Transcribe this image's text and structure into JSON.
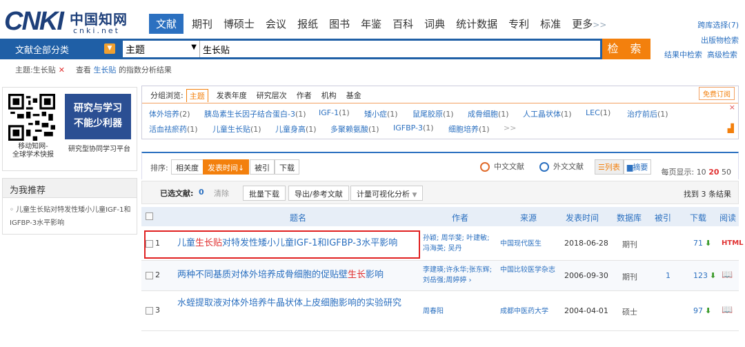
{
  "logo": {
    "brand": "CNKI",
    "chinese": "中国知网",
    "domain": "cnki.net"
  },
  "topnav": {
    "active": "文献",
    "items": [
      "期刊",
      "博硕士",
      "会议",
      "报纸",
      "图书",
      "年鉴",
      "百科",
      "词典",
      "统计数据",
      "专利",
      "标准"
    ],
    "more": "更多",
    "more_arrow": ">>"
  },
  "rightlinks": {
    "cross_db": "跨库选择(7)",
    "publisher": "出版物检索"
  },
  "search": {
    "category": "文献全部分类",
    "field": "主题",
    "query": "生长贴",
    "button": "检 索",
    "in_results": "结果中检索",
    "advanced": "高级检索"
  },
  "crumbs": {
    "term": "主题:生长贴",
    "close": "✕",
    "analyze_prefix": "查看",
    "analyze_kw": "生长贴",
    "analyze_suffix": "的指数分析结果"
  },
  "promo": {
    "qr_caption": "移动知网-\n全球学术快报",
    "banner_text": "研究与学习\n不能少利器",
    "banner_caption": "研究型协同学习平台"
  },
  "recommend": {
    "heading": "为我推荐",
    "item": "儿童生长贴对特发性矮小儿童IGF-1和IGFBP-3水平影响"
  },
  "group": {
    "label": "分组浏览:",
    "tabs": [
      "主题",
      "发表年度",
      "研究层次",
      "作者",
      "机构",
      "基金"
    ],
    "subscribe": "免费订阅",
    "close": "×",
    "chart_icon": "▟",
    "row1": [
      {
        "t": "体外培养",
        "c": "(2)"
      },
      {
        "t": "胰岛素生长因子结合蛋白-3",
        "c": "(1)"
      },
      {
        "t": "IGF-1",
        "c": "(1)"
      },
      {
        "t": "矮小症",
        "c": "(1)"
      },
      {
        "t": "鼠尾胶原",
        "c": "(1)"
      },
      {
        "t": "成骨细胞",
        "c": "(1)"
      },
      {
        "t": "人工晶状体",
        "c": "(1)"
      },
      {
        "t": "LEC",
        "c": "(1)"
      },
      {
        "t": "治疗前后",
        "c": "(1)"
      }
    ],
    "row2": [
      {
        "t": "活血祛瘀药",
        "c": "(1)"
      },
      {
        "t": "儿童生长贴",
        "c": "(1)"
      },
      {
        "t": "儿童身高",
        "c": "(1)"
      },
      {
        "t": "多聚赖氨酸",
        "c": "(1)"
      },
      {
        "t": "IGFBP-3",
        "c": "(1)"
      },
      {
        "t": "细胞培养",
        "c": "(1)"
      },
      {
        "t": ">>",
        "c": ""
      }
    ]
  },
  "sort": {
    "label": "排序:",
    "options": [
      "相关度",
      "发表时间",
      "被引",
      "下载"
    ],
    "active_arrow": "↓",
    "cn": "中文文献",
    "foreign": "外文文献",
    "list": "☰列表",
    "abstract": "▆摘要",
    "perpage_label": "每页显示:",
    "perpage": [
      "10",
      "20",
      "50"
    ]
  },
  "selbar": {
    "selected": "已选文献:",
    "count": "0",
    "clear": "清除",
    "batch": "批量下载",
    "export": "导出/参考文献",
    "viz": "计量可视化分析",
    "found": "找到 3 条结果"
  },
  "thead": {
    "title": "题名",
    "author": "作者",
    "source": "来源",
    "date": "发表时间",
    "db": "数据库",
    "cite": "被引",
    "download": "下载",
    "read": "阅读"
  },
  "results": [
    {
      "num": "1",
      "title_a": "儿童",
      "kw": "生长贴",
      "title_b": "对特发性矮小儿童IGF-1和IGFBP-3水平影响",
      "authors": "孙颖; 周华斐; 叶建敏; 冯海英; 吴丹",
      "source": "中国现代医生",
      "date": "2018-06-28",
      "db": "期刊",
      "cite": "",
      "download": "71",
      "read": "HTML"
    },
    {
      "num": "2",
      "title_a": "两种不同基质对体外培养成骨细胞的促贴壁",
      "kw": "生长",
      "title_b": "影响",
      "authors": "李建瑛;许永华;张东辉;刘岳强;周婷婷 ›",
      "source": "中国比较医学杂志",
      "date": "2006-09-30",
      "db": "期刊",
      "cite": "1",
      "download": "123",
      "read": "📖"
    },
    {
      "num": "3",
      "title_a": "水蛭提取液对体外培养牛晶状体上皮细胞影响的实验研究",
      "kw": "",
      "title_b": "",
      "authors": "周春阳",
      "source": "成都中医药大学",
      "date": "2004-04-01",
      "db": "硕士",
      "cite": "",
      "download": "97",
      "read": "📖"
    }
  ]
}
